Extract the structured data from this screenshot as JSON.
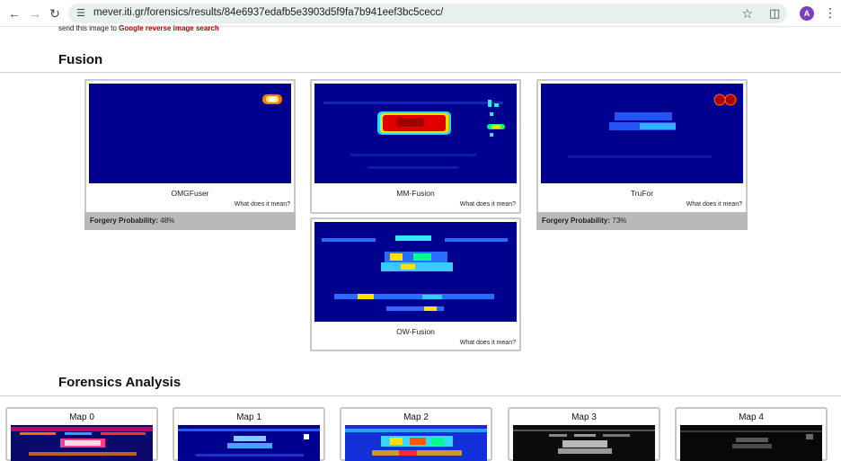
{
  "browser": {
    "url": "mever.iti.gr/forensics/results/84e6937edafb5e3903d5f9fa7b941eef3bc5cecc/",
    "avatar_letter": "A"
  },
  "page": {
    "send_text": "send this image to ",
    "send_link": "Google reverse image search",
    "fusion_title": "Fusion",
    "forensics_title": "Forensics Analysis",
    "meaning_label": "What does it mean?",
    "prob_label": "Forgery Probability:"
  },
  "fusion": [
    {
      "name": "OMGFuser",
      "probability": "48%"
    },
    {
      "name": "MM-Fusion"
    },
    {
      "name": "TruFor",
      "probability": "73%"
    },
    {
      "name": "OW-Fusion"
    }
  ],
  "maps": [
    {
      "label": "Map 0"
    },
    {
      "label": "Map 1"
    },
    {
      "label": "Map 2"
    },
    {
      "label": "Map 3"
    },
    {
      "label": "Map 4"
    }
  ],
  "colors": {
    "heat_bg": "#00008e",
    "link_red": "#b00000",
    "avatar": "#7b3fbf"
  }
}
